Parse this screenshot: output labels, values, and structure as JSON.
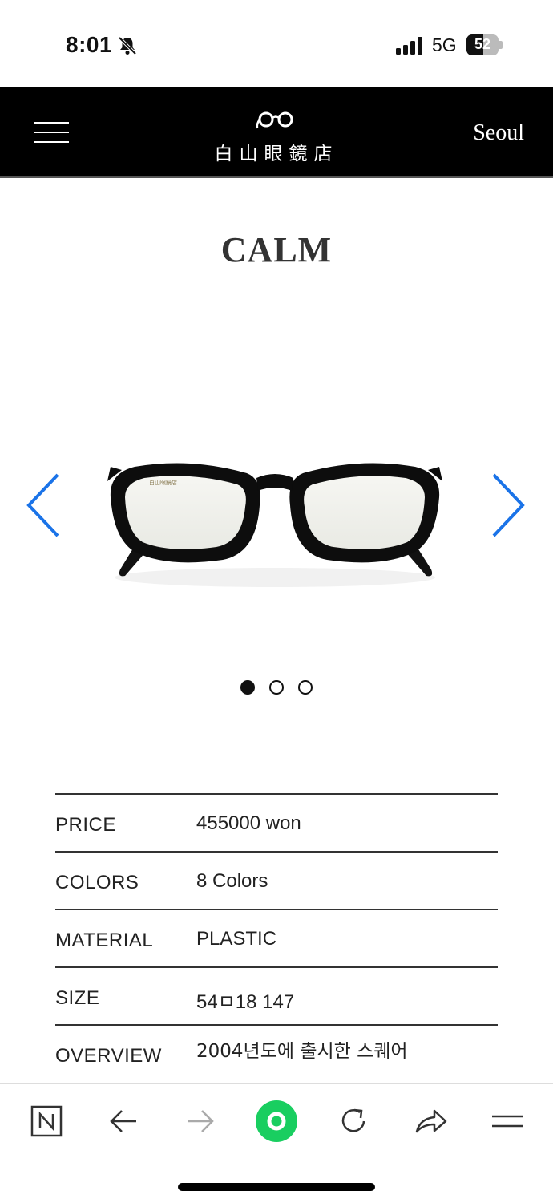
{
  "status_bar": {
    "time": "8:01",
    "network": "5G",
    "battery": "52",
    "battery_level": 0.52,
    "icons": [
      "bell-slash-icon",
      "signal-bars-icon",
      "battery-icon"
    ]
  },
  "header": {
    "logo_text": "白山眼鏡店",
    "city": "Seoul",
    "icons": [
      "hamburger-menu-icon",
      "glasses-logo-icon"
    ],
    "background": "#000000"
  },
  "product": {
    "title": "CALM",
    "carousel": {
      "slide_count": 3,
      "active_index": 0,
      "arrow_color": "#1a73e8",
      "icons": [
        "chevron-left-icon",
        "chevron-right-icon"
      ]
    },
    "specs": [
      {
        "label": "PRICE",
        "value": "455000 won"
      },
      {
        "label": "COLORS",
        "value": "8 Colors"
      },
      {
        "label": "MATERIAL",
        "value": "PLASTIC"
      },
      {
        "label": "SIZE",
        "value": "54ㅁ18 147"
      },
      {
        "label": "OVERVIEW",
        "value": "2004년도에 출시한 스퀘어"
      }
    ]
  },
  "browser_toolbar": {
    "icons": [
      "naver-n-icon",
      "back-arrow-icon",
      "forward-arrow-icon",
      "green-home-icon",
      "reload-icon",
      "share-icon",
      "menu-icon"
    ],
    "accent": "#19ce60"
  }
}
